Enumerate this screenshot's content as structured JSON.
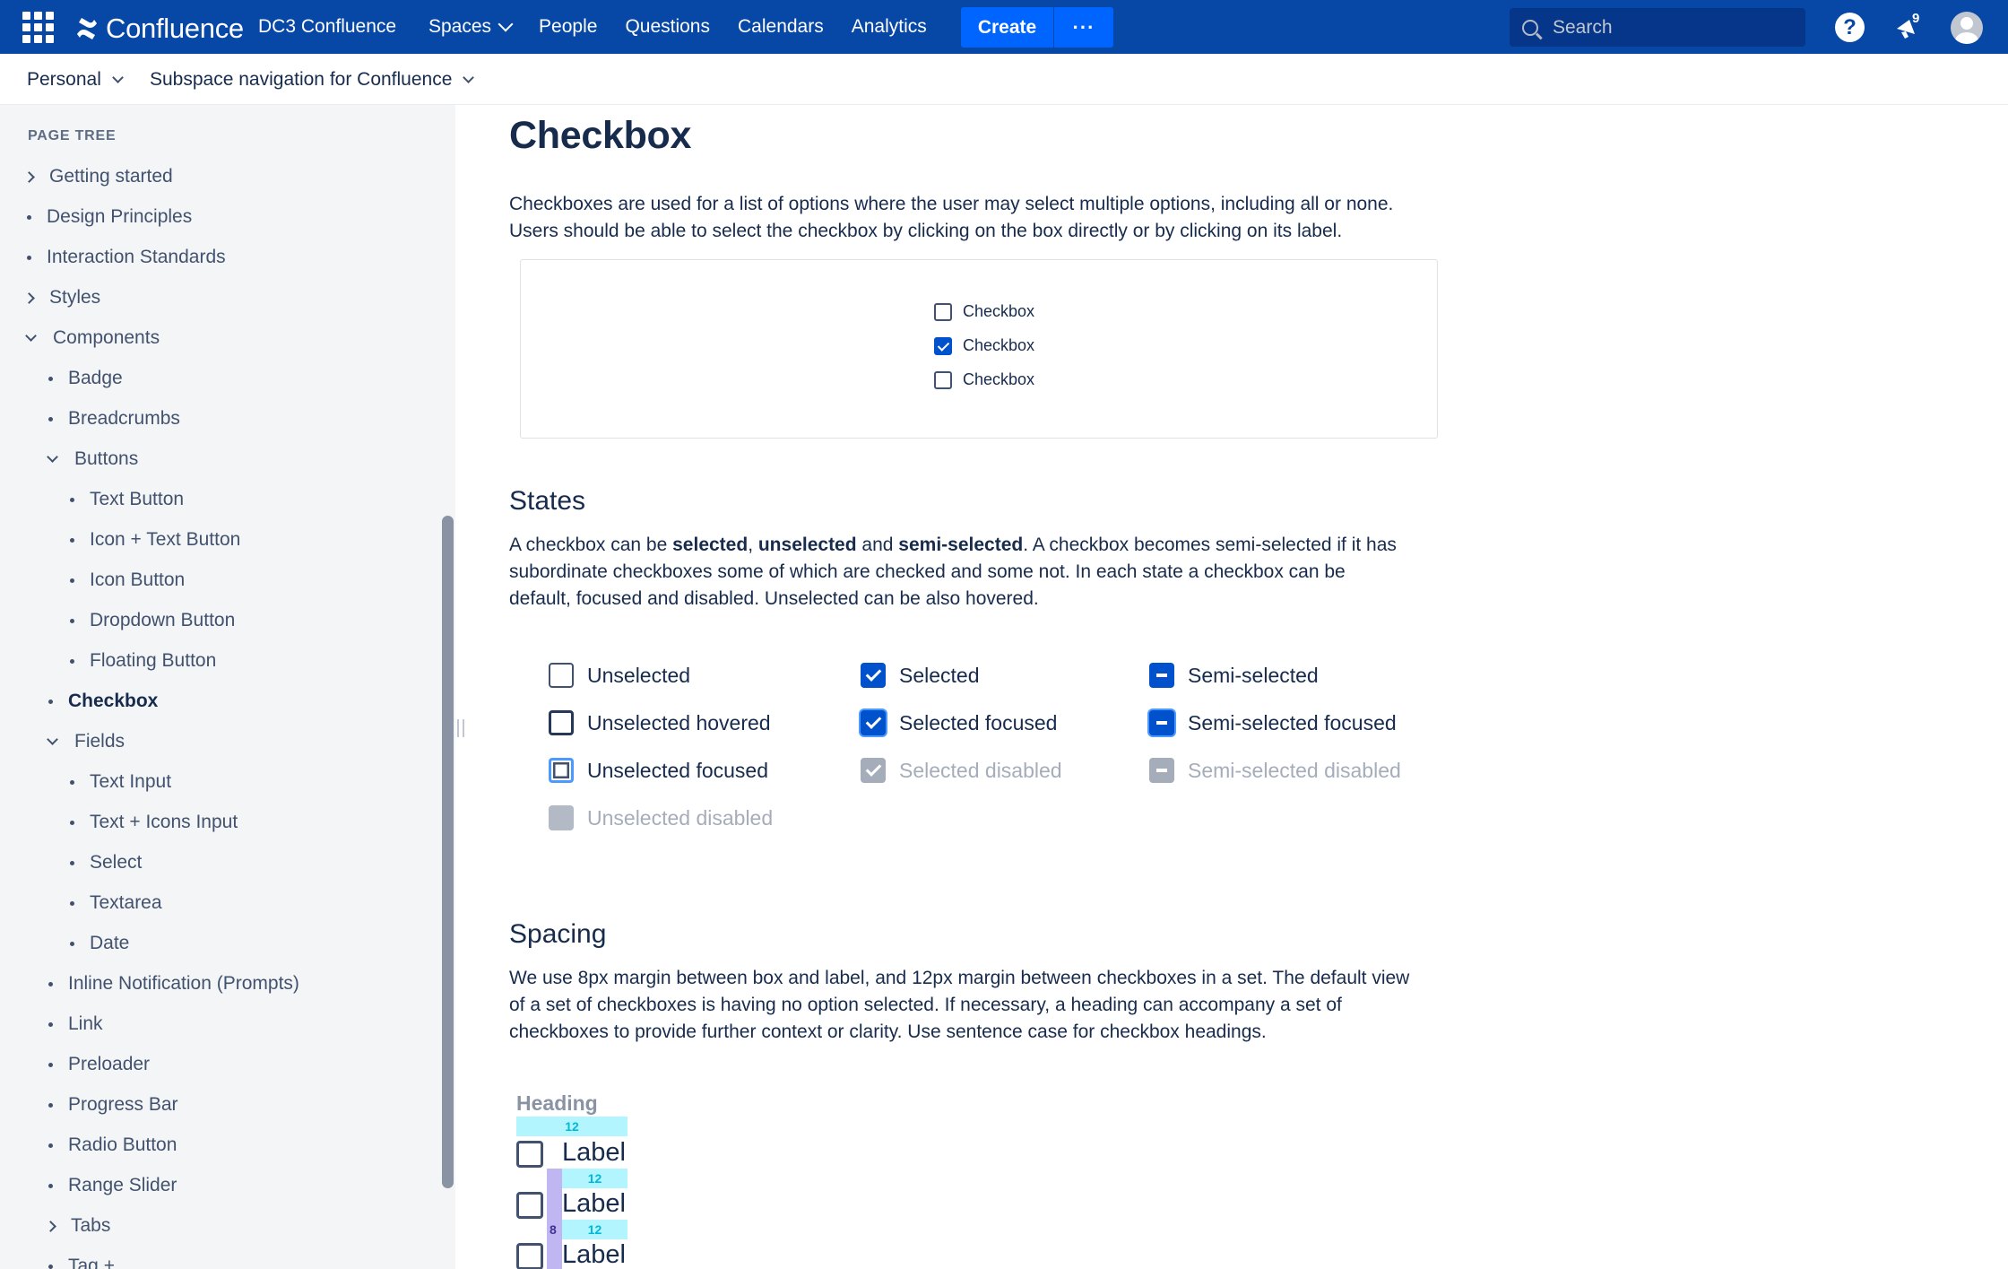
{
  "topnav": {
    "logo_text": "Confluence",
    "site_name": "DC3 Confluence",
    "links": [
      "Spaces",
      "People",
      "Questions",
      "Calendars",
      "Analytics"
    ],
    "create_label": "Create",
    "more_label": "···",
    "search_placeholder": "Search",
    "help_label": "?",
    "notification_count": "9"
  },
  "subnav": {
    "space": "Personal",
    "page": "Subspace navigation for Confluence"
  },
  "sidebar": {
    "title": "PAGE TREE",
    "items": [
      {
        "label": "Getting started",
        "marker": "right",
        "level": 0
      },
      {
        "label": "Design Principles",
        "marker": "bullet",
        "level": 0
      },
      {
        "label": "Interaction Standards",
        "marker": "bullet",
        "level": 0
      },
      {
        "label": "Styles",
        "marker": "right",
        "level": 0
      },
      {
        "label": "Components",
        "marker": "down",
        "level": 0
      },
      {
        "label": "Badge",
        "marker": "bullet",
        "level": 1
      },
      {
        "label": "Breadcrumbs",
        "marker": "bullet",
        "level": 1
      },
      {
        "label": "Buttons",
        "marker": "down",
        "level": 1
      },
      {
        "label": "Text Button",
        "marker": "bullet",
        "level": 2
      },
      {
        "label": "Icon + Text Button",
        "marker": "bullet",
        "level": 2
      },
      {
        "label": "Icon Button",
        "marker": "bullet",
        "level": 2
      },
      {
        "label": "Dropdown Button",
        "marker": "bullet",
        "level": 2
      },
      {
        "label": "Floating Button",
        "marker": "bullet",
        "level": 2
      },
      {
        "label": "Checkbox",
        "marker": "bullet",
        "level": 1,
        "active": true
      },
      {
        "label": "Fields",
        "marker": "down",
        "level": 1
      },
      {
        "label": "Text Input",
        "marker": "bullet",
        "level": 2
      },
      {
        "label": "Text + Icons Input",
        "marker": "bullet",
        "level": 2
      },
      {
        "label": "Select",
        "marker": "bullet",
        "level": 2
      },
      {
        "label": "Textarea",
        "marker": "bullet",
        "level": 2
      },
      {
        "label": "Date",
        "marker": "bullet",
        "level": 2
      },
      {
        "label": "Inline Notification (Prompts)",
        "marker": "bullet",
        "level": 1
      },
      {
        "label": "Link",
        "marker": "bullet",
        "level": 1
      },
      {
        "label": "Preloader",
        "marker": "bullet",
        "level": 1
      },
      {
        "label": "Progress Bar",
        "marker": "bullet",
        "level": 1
      },
      {
        "label": "Radio Button",
        "marker": "bullet",
        "level": 1
      },
      {
        "label": "Range Slider",
        "marker": "bullet",
        "level": 1
      },
      {
        "label": "Tabs",
        "marker": "right",
        "level": 1
      },
      {
        "label": "Tag + ...",
        "marker": "bullet",
        "level": 1
      }
    ]
  },
  "main": {
    "title": "Checkbox",
    "intro_1": "Checkboxes are used for a list of options where the user may select multiple options, including all or none.",
    "intro_2": "Users should be able to select the checkbox by clicking on the box directly or by clicking on its label.",
    "demo": [
      {
        "label": "Checkbox",
        "checked": false
      },
      {
        "label": "Checkbox",
        "checked": true
      },
      {
        "label": "Checkbox",
        "checked": false
      }
    ],
    "states_heading": "States",
    "states_para": {
      "pre": "A checkbox can be ",
      "b1": "selected",
      "sep1": ", ",
      "b2": "unselected",
      "sep2": " and ",
      "b3": "semi-selected",
      "post_1": ". A checkbox becomes semi-selected if it has",
      "line2": "subordinate checkboxes some of which are checked and some not. In each state a checkbox can be",
      "line3": "default, focused and disabled. Unselected can be also hovered."
    },
    "states": {
      "unselected": "Unselected",
      "unselected_hovered": "Unselected hovered",
      "unselected_focused": "Unselected focused",
      "unselected_disabled": "Unselected disabled",
      "selected": "Selected",
      "selected_focused": "Selected focused",
      "selected_disabled": "Selected disabled",
      "semi_selected": "Semi-selected",
      "semi_selected_focused": "Semi-selected focused",
      "semi_selected_disabled": "Semi-selected disabled"
    },
    "spacing_heading": "Spacing",
    "spacing_line1": "We use 8px margin between box and label, and 12px margin between checkboxes in a set. The default view",
    "spacing_line2": "of a set of checkboxes is having no option selected. If necessary, a heading can accompany a set of",
    "spacing_line3": "checkboxes to provide further context or clarity. Use sentence case for checkbox headings.",
    "spacing_example": {
      "heading": "Heading",
      "gap_label": "12",
      "margin_label": "8",
      "item_label": "Label"
    }
  },
  "colors": {
    "nav_bg": "#0747a6",
    "create_bg": "#0065ff",
    "checkbox_selected": "#0052cc",
    "sidebar_bg": "#f4f5f7"
  }
}
